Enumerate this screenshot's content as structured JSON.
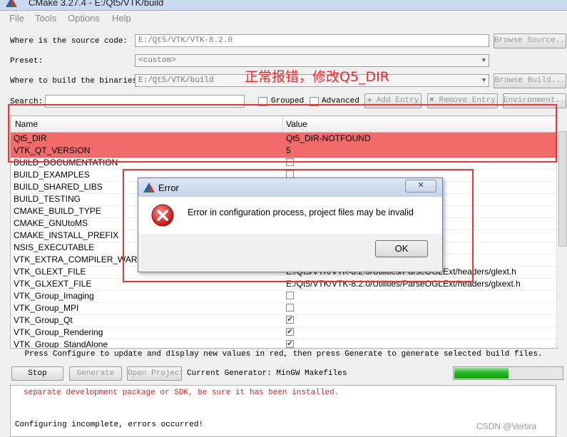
{
  "window": {
    "title": "CMake 3.27.4 - E:/Qt5/VTK/build"
  },
  "menu": [
    "File",
    "Tools",
    "Options",
    "Help"
  ],
  "source": {
    "label": "Where is the source code:",
    "value": "E:/Qt5/VTK/VTK-8.2.0",
    "browse_label": "Browse Source..."
  },
  "preset": {
    "label": "Preset:",
    "value": "<custom>"
  },
  "build": {
    "label": "Where to build the binaries:",
    "value": "E:/Qt5/VTK/build",
    "browse_label": "Browse Build..."
  },
  "search": {
    "label": "Search:",
    "value": "",
    "grouped_label": "Grouped",
    "advanced_label": "Advanced",
    "add_entry_label": "Add Entry",
    "remove_entry_label": "Remove Entry",
    "environment_label": "Environment..."
  },
  "annotation": "正常报错，修改Q5_DIR",
  "table": {
    "headers": [
      "Name",
      "Value"
    ],
    "rows": [
      {
        "name": "Qt5_DIR",
        "value": "Qt5_DIR-NOTFOUND",
        "type": "text",
        "highlight": true
      },
      {
        "name": "VTK_QT_VERSION",
        "value": "5",
        "type": "text",
        "highlight": true
      },
      {
        "name": "BUILD_DOCUMENTATION",
        "value": "",
        "type": "check",
        "checked": false
      },
      {
        "name": "BUILD_EXAMPLES",
        "value": "",
        "type": "check",
        "checked": false
      },
      {
        "name": "BUILD_SHARED_LIBS",
        "value": "",
        "type": "hidden"
      },
      {
        "name": "BUILD_TESTING",
        "value": "",
        "type": "hidden"
      },
      {
        "name": "CMAKE_BUILD_TYPE",
        "value": "",
        "type": "hidden"
      },
      {
        "name": "CMAKE_GNUtoMS",
        "value": "",
        "type": "hidden"
      },
      {
        "name": "CMAKE_INSTALL_PREFIX",
        "value": "",
        "type": "hidden"
      },
      {
        "name": "NSIS_EXECUTABLE",
        "value": "",
        "type": "hidden"
      },
      {
        "name": "VTK_EXTRA_COMPILER_WARN",
        "value": "",
        "type": "hidden"
      },
      {
        "name": "VTK_GLEXT_FILE",
        "value": "E:/Qt5/VTK/VTK-8.2.0/Utilities/ParseOGLExt/headers/glext.h",
        "type": "text"
      },
      {
        "name": "VTK_GLXEXT_FILE",
        "value": "E:/Qt5/VTK/VTK-8.2.0/Utilities/ParseOGLExt/headers/glxext.h",
        "type": "text"
      },
      {
        "name": "VTK_Group_Imaging",
        "value": "",
        "type": "check",
        "checked": false
      },
      {
        "name": "VTK_Group_MPI",
        "value": "",
        "type": "check",
        "checked": false
      },
      {
        "name": "VTK_Group_Qt",
        "value": "",
        "type": "check",
        "checked": true
      },
      {
        "name": "VTK_Group_Rendering",
        "value": "",
        "type": "check",
        "checked": true
      },
      {
        "name": "VTK_Group_StandAlone",
        "value": "",
        "type": "check",
        "checked": true
      }
    ]
  },
  "dialog": {
    "title": "Error",
    "message": "Error in configuration process, project files may be invalid",
    "ok_label": "OK",
    "close_label": "✕"
  },
  "status_text": "Press Configure to update and display new values in red, then press Generate to generate selected build files.",
  "buttons": {
    "stop": "Stop",
    "generate": "Generate",
    "open_project": "Open Project"
  },
  "generator": "Current Generator: MinGW Makefiles",
  "progress": 0.5,
  "log": {
    "lines": [
      {
        "text": "separate development package or SDK, be sure it has been installed.",
        "color": "#d42020"
      },
      {
        "text": "",
        "color": "#000000"
      },
      {
        "text": "",
        "color": "#000000"
      },
      {
        "text": "Configuring incomplete, errors occurred!",
        "color": "#000000"
      }
    ]
  },
  "watermark": "CSDN @Vertira"
}
